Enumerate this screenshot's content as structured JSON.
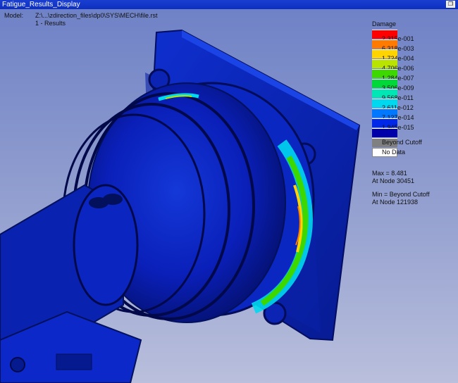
{
  "window": {
    "title": "Fatigue_Results_Display",
    "restore_icon": "restore-icon"
  },
  "header": {
    "model_label": "Model:",
    "model_path": "Z:\\...\\zdirection_files\\dp0\\SYS\\MECH\\file.rst",
    "result_set": "1 - Results"
  },
  "legend": {
    "title": "Damage",
    "bands": [
      {
        "color": "#ff0000",
        "label": "2.315e-001"
      },
      {
        "color": "#ff7a00",
        "label": "6.318e-003"
      },
      {
        "color": "#ffd400",
        "label": "1.724e-004"
      },
      {
        "color": "#b8e400",
        "label": "4.706e-006"
      },
      {
        "color": "#3cd800",
        "label": "1.284e-007"
      },
      {
        "color": "#00d83a",
        "label": "3.506e-009"
      },
      {
        "color": "#00e6b4",
        "label": "9.568e-011"
      },
      {
        "color": "#00d8f0",
        "label": "2.611e-012"
      },
      {
        "color": "#0078ff",
        "label": "7.127e-014"
      },
      {
        "color": "#0028e6",
        "label": "1.945e-015"
      },
      {
        "color": "#0000a8",
        "label": ""
      },
      {
        "color": "#808080",
        "label": "Beyond Cutoff"
      },
      {
        "color": "#ffffff",
        "label": "No Data"
      }
    ]
  },
  "stats": {
    "max": "Max = 8.481",
    "max_node": "At Node 30451",
    "min": "Min = Beyond Cutoff",
    "min_node": "At Node 121938"
  }
}
